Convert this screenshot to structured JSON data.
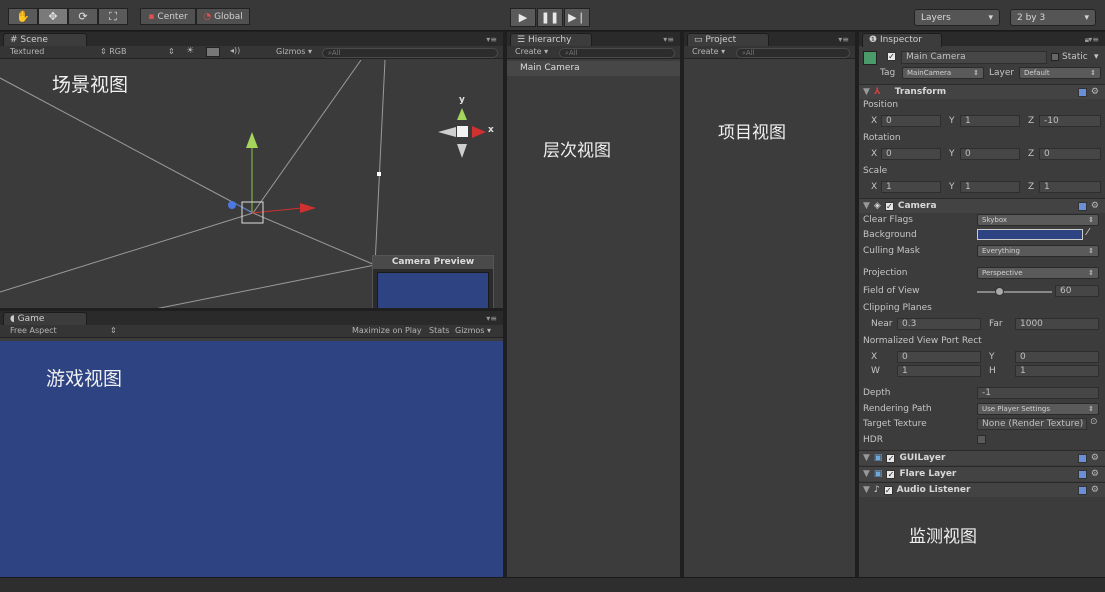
{
  "toolbar": {
    "pivot": "Center",
    "space": "Global",
    "layers": "Layers",
    "layout": "2 by 3"
  },
  "scene": {
    "tab": "Scene",
    "render_mode": "Textured",
    "color_mode": "RGB",
    "gizmos": "Gizmos",
    "search_placeholder": "All",
    "annotation": "场景视图",
    "axis_y": "y",
    "axis_x": "x",
    "camera_preview_title": "Camera Preview"
  },
  "game": {
    "tab": "Game",
    "aspect": "Free Aspect",
    "maximize": "Maximize on Play",
    "stats": "Stats",
    "gizmos": "Gizmos",
    "annotation": "游戏视图",
    "background_color": "#2e4482"
  },
  "hierarchy": {
    "tab": "Hierarchy",
    "create": "Create",
    "search_placeholder": "All",
    "items": [
      "Main Camera"
    ],
    "annotation": "层次视图"
  },
  "project": {
    "tab": "Project",
    "create": "Create",
    "search_placeholder": "All",
    "annotation": "项目视图"
  },
  "inspector": {
    "tab": "Inspector",
    "object_name": "Main Camera",
    "static_label": "Static",
    "tag_label": "Tag",
    "tag_value": "MainCamera",
    "layer_label": "Layer",
    "layer_value": "Default",
    "transform": {
      "title": "Transform",
      "position_label": "Position",
      "rotation_label": "Rotation",
      "scale_label": "Scale",
      "x": "X",
      "y": "Y",
      "z": "Z",
      "position": [
        "0",
        "1",
        "-10"
      ],
      "rotation": [
        "0",
        "0",
        "0"
      ],
      "scale": [
        "1",
        "1",
        "1"
      ]
    },
    "camera": {
      "title": "Camera",
      "clear_flags_label": "Clear Flags",
      "clear_flags": "Skybox",
      "background_label": "Background",
      "background_color": "#2e4482",
      "culling_mask_label": "Culling Mask",
      "culling_mask": "Everything",
      "projection_label": "Projection",
      "projection": "Perspective",
      "fov_label": "Field of View",
      "fov": "60",
      "fov_fraction": 0.3,
      "clipping_label": "Clipping Planes",
      "near_label": "Near",
      "near": "0.3",
      "far_label": "Far",
      "far": "1000",
      "viewport_label": "Normalized View Port Rect",
      "vp_x_label": "X",
      "vp_x": "0",
      "vp_y_label": "Y",
      "vp_y": "0",
      "vp_w_label": "W",
      "vp_w": "1",
      "vp_h_label": "H",
      "vp_h": "1",
      "depth_label": "Depth",
      "depth": "-1",
      "rendering_path_label": "Rendering Path",
      "rendering_path": "Use Player Settings",
      "target_texture_label": "Target Texture",
      "target_texture": "None (Render Texture)",
      "hdr_label": "HDR"
    },
    "components": [
      "GUILayer",
      "Flare Layer",
      "Audio Listener"
    ],
    "annotation": "监测视图"
  }
}
